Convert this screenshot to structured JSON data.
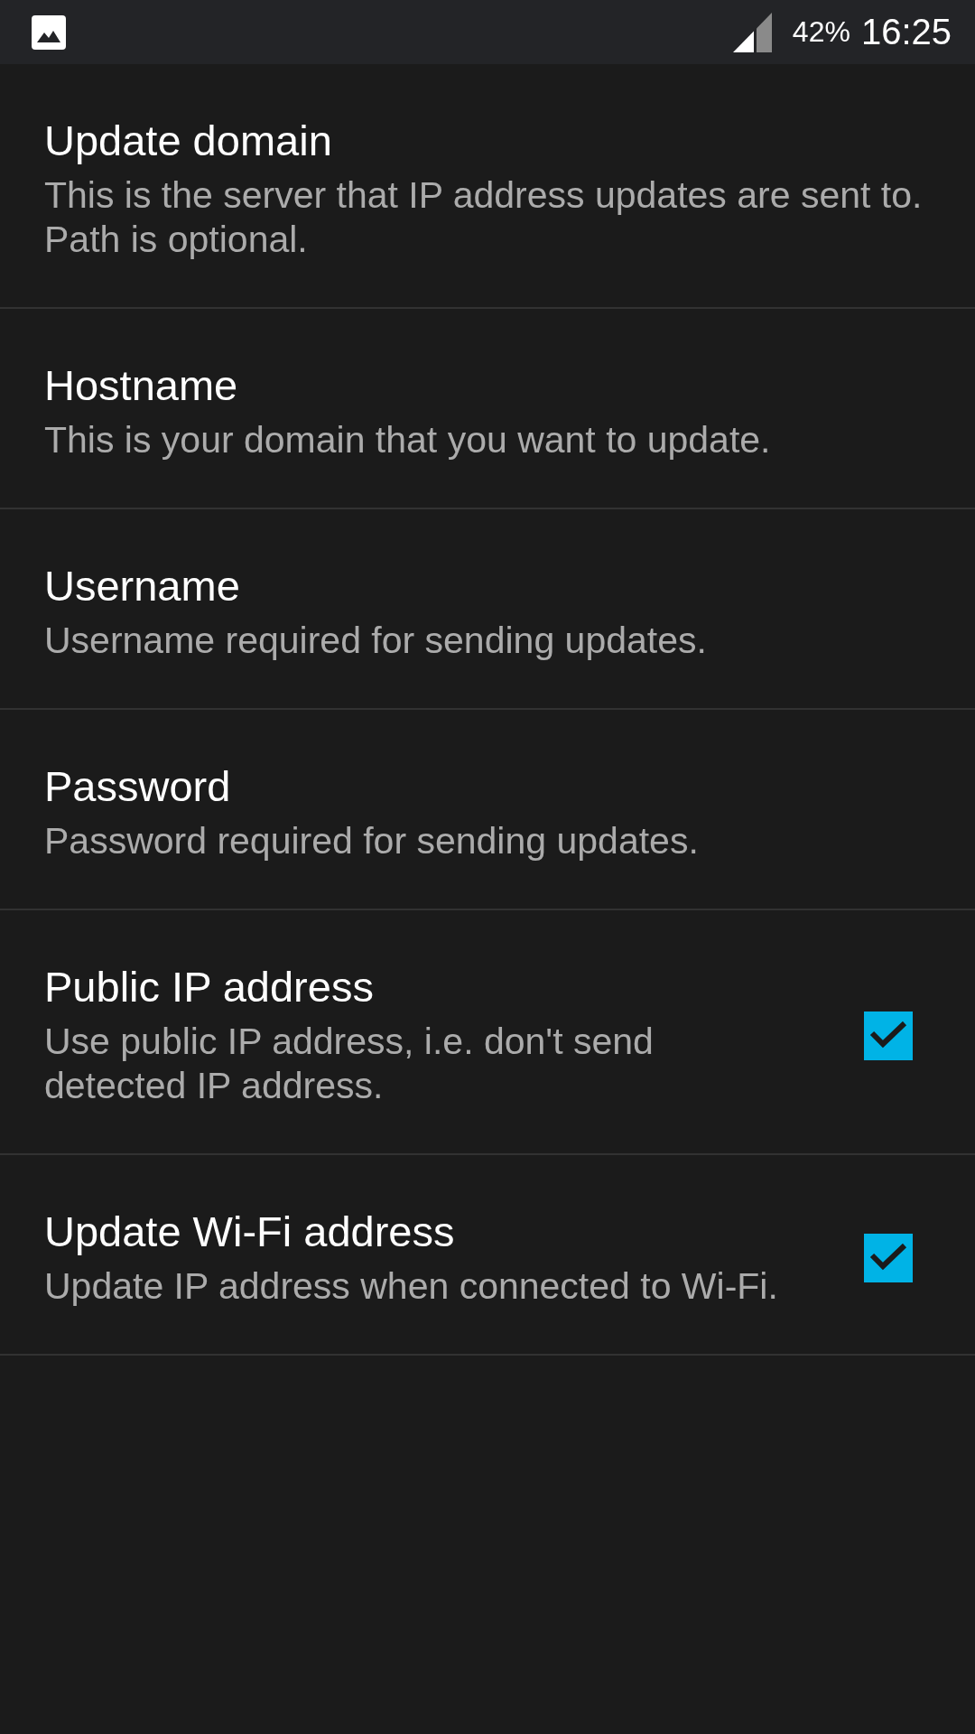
{
  "status_bar": {
    "battery": "42%",
    "time": "16:25"
  },
  "preferences": [
    {
      "kind": "text",
      "title": "Update domain",
      "summary": "This is the server that IP address updates are sent to. Path is optional."
    },
    {
      "kind": "text",
      "title": "Hostname",
      "summary": "This is your domain that you want to update."
    },
    {
      "kind": "text",
      "title": "Username",
      "summary": "Username required for sending updates."
    },
    {
      "kind": "text",
      "title": "Password",
      "summary": "Password required for sending updates."
    },
    {
      "kind": "checkbox",
      "title": "Public IP address",
      "summary": "Use public IP address, i.e. don't send detected IP address.",
      "checked": true
    },
    {
      "kind": "checkbox",
      "title": "Update Wi-Fi address",
      "summary": "Update IP address when connected to Wi-Fi.",
      "checked": true
    }
  ]
}
